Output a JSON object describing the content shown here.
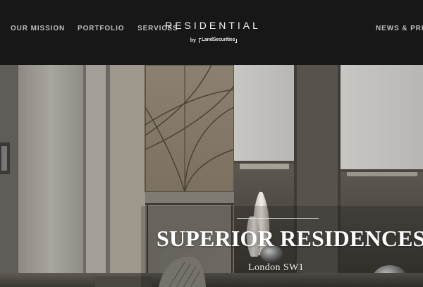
{
  "header": {
    "nav_left": [
      "OUR MISSION",
      "PORTFOLIO",
      "SERVICES"
    ],
    "nav_right": [
      "NEWS & PRES"
    ],
    "brand": {
      "wordmark": "RESIDENTIAL",
      "by": "by",
      "partner": "LandSecurities"
    }
  },
  "hero": {
    "title": "SUPERIOR RESIDENCES",
    "location": "London SW1"
  },
  "colors": {
    "header_bg": "#171717",
    "nav_text": "#bdbdbd",
    "brand_text": "#f2f2f2",
    "hero_text": "#ffffff"
  }
}
